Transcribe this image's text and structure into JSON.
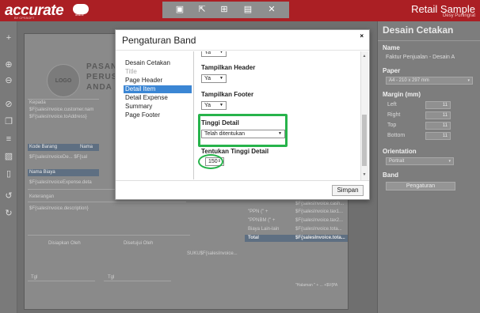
{
  "app": {
    "logo": "accurate",
    "logo_sub": "BY CPSSOFT",
    "cloud_label": "online",
    "title": "Retail Sample",
    "user": "Desy Puningrat"
  },
  "toolbar": {
    "icons": [
      "save-icon",
      "open-icon",
      "add-icon",
      "chart-icon",
      "close-icon"
    ]
  },
  "left_toolbar": {
    "icons": [
      "plus-icon",
      "zoom-in-icon",
      "zoom-out-icon",
      "undo-icon",
      "copy-icon",
      "align-icon",
      "image-icon",
      "trash-icon",
      "back-icon",
      "refresh-icon"
    ]
  },
  "paper_preview": {
    "logo": "LOGO",
    "header_line1": "PASANG",
    "header_line2": "PERUSAH",
    "header_line3": "ANDA D",
    "kepada": "Kepada",
    "customer": "$F{salesInvoice.customer.nam",
    "address": "$F{salesInvoice.toAddress}",
    "kode_barang": "Kode Barang",
    "nama": "Nama",
    "item_row": "$F{salesInvoiceDe...   $F{sal",
    "nama_biaya": "Nama Biaya",
    "expense_row": "$F{salesInvoiceExpense.deta",
    "keterangan": "Keterangan",
    "description": "$F{salesInvoice.description}",
    "disiapkan": "Disiapkan Oleh",
    "disetujui": "Disetujui Oleh",
    "suku": "SUKU$F{salesInvoice...",
    "tgl1": "Tgl",
    "tgl2": "Tgl",
    "ppn": "\"PPN (\" +",
    "pph": "\"PPNBM (\" +",
    "biaya": "Biaya Lain-lain",
    "total": "Total",
    "cash": "$F{salesInvoice.cash...",
    "tax1": "$F{salesInvoice.tax1...",
    "tax2": "$F{salesInvoice.tax2...",
    "tota": "$F{salesInvoice.tota...",
    "total_val": "$F{salesInvoice.tota...",
    "halaman": "\"Halaman \" + ... +$V{PA"
  },
  "right_panel": {
    "title": "Desain Cetakan",
    "name_label": "Name",
    "name_value": "Faktur Penjualan - Desain A",
    "paper_label": "Paper",
    "paper_value": "A4 - 210 x 297 mm",
    "margin_label": "Margin (mm)",
    "left_label": "Left",
    "left_value": "11",
    "right_label": "Right",
    "right_value": "11",
    "top_label": "Top",
    "top_value": "11",
    "bottom_label": "Bottom",
    "bottom_value": "11",
    "orientation_label": "Orientation",
    "orientation_value": "Portrait",
    "band_label": "Band",
    "band_button": "Pengaturan"
  },
  "modal": {
    "title": "Pengaturan Band",
    "close": "×",
    "nav": [
      {
        "label": "Desain Cetakan",
        "state": "normal"
      },
      {
        "label": "Title",
        "state": "disabled"
      },
      {
        "label": "Page Header",
        "state": "normal"
      },
      {
        "label": "Detail Item",
        "state": "active"
      },
      {
        "label": "Detail Expense",
        "state": "normal"
      },
      {
        "label": "Summary",
        "state": "normal"
      },
      {
        "label": "Page Footer",
        "state": "normal"
      }
    ],
    "fields": {
      "top_select": "Ya",
      "tampilkan_header_label": "Tampilkan Header",
      "tampilkan_header_value": "Ya",
      "tampilkan_footer_label": "Tampilkan Footer",
      "tampilkan_footer_value": "Ya",
      "tinggi_detail_label": "Tinggi Detail",
      "tinggi_detail_value": "Telah ditentukan",
      "tentukan_tinggi_label": "Tentukan Tinggi Detail",
      "tentukan_tinggi_value": "150"
    },
    "save_button": "Simpan",
    "highlight_color": "#27b34b"
  }
}
